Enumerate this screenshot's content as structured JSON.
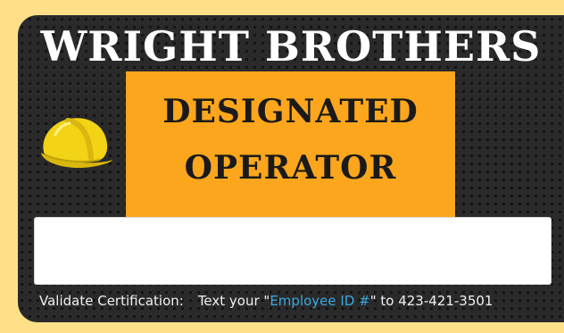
{
  "card": {
    "brand": "WRIGHT BROTHERS",
    "title_line1": "DESIGNATED",
    "title_line2": "OPERATOR",
    "hardhat_icon": "hard-hat-icon",
    "footer": {
      "label": "Validate Certification:",
      "text_before": "Text your \"",
      "highlight": "Employee ID #",
      "text_after": "\" to 423-421-3501"
    }
  },
  "colors": {
    "background": "#FFE089",
    "card": "#2a2a2a",
    "panel": "#FCA61D",
    "hardhat": "#F2D315",
    "highlight": "#38A9E0"
  }
}
